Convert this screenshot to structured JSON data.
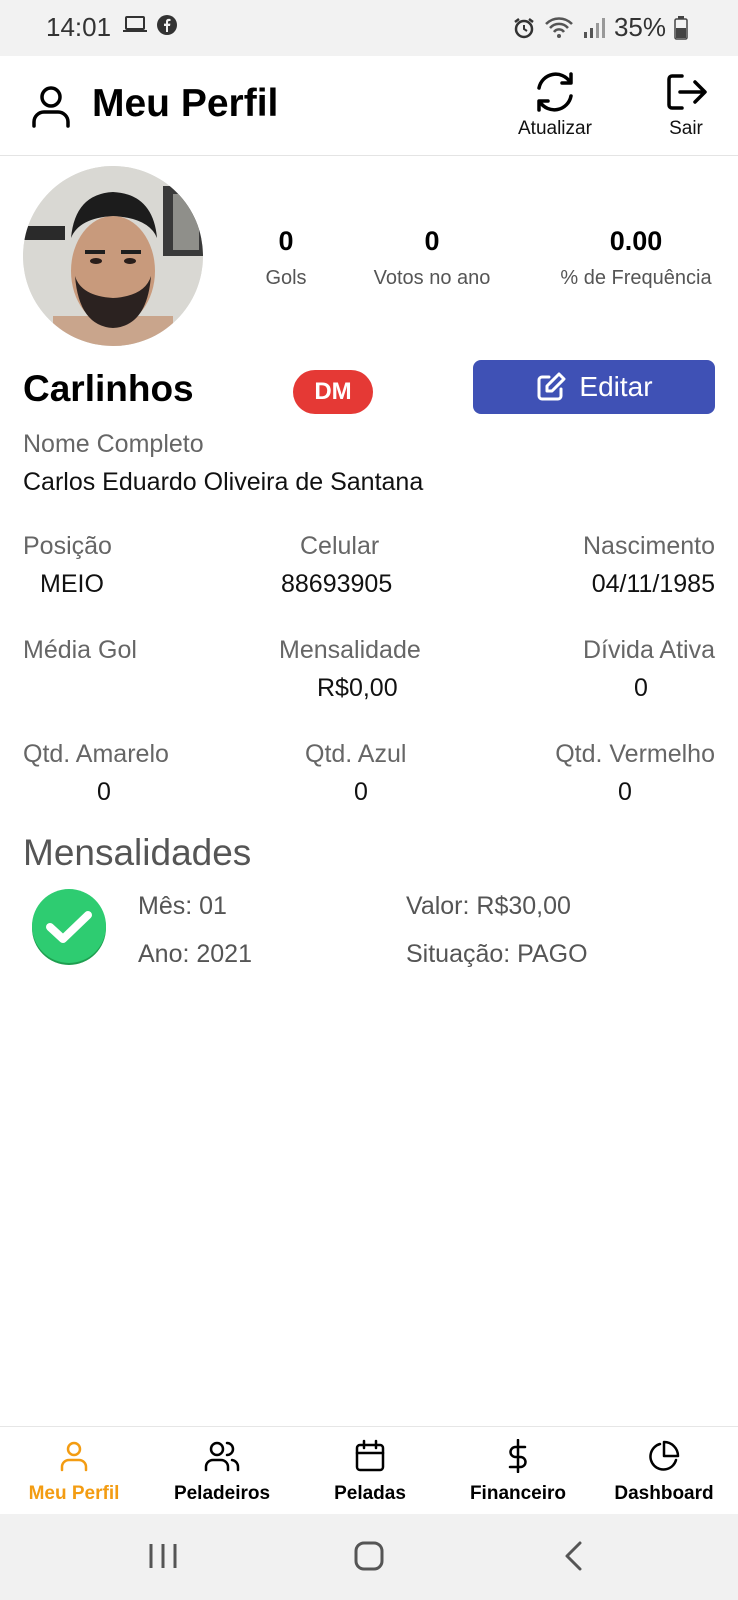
{
  "status_bar": {
    "time": "14:01",
    "battery": "35%"
  },
  "header": {
    "title": "Meu Perfil",
    "refresh_label": "Atualizar",
    "logout_label": "Sair"
  },
  "stats": [
    {
      "value": "0",
      "label": "Gols"
    },
    {
      "value": "0",
      "label": "Votos no ano"
    },
    {
      "value": "0.00",
      "label": "% de Frequência"
    }
  ],
  "profile": {
    "nickname": "Carlinhos",
    "badge": "DM",
    "edit_label": "Editar",
    "full_name_label": "Nome Completo",
    "full_name": "Carlos Eduardo Oliveira de Santana"
  },
  "fields": {
    "posicao": {
      "label": "Posição",
      "value": "MEIO"
    },
    "celular": {
      "label": "Celular",
      "value": "88693905"
    },
    "nascimento": {
      "label": "Nascimento",
      "value": "04/11/1985"
    },
    "media_gol": {
      "label": "Média Gol",
      "value": ""
    },
    "mensalidade": {
      "label": "Mensalidade",
      "value": "R$0,00"
    },
    "divida_ativa": {
      "label": "Dívida Ativa",
      "value": "0"
    },
    "qtd_amarelo": {
      "label": "Qtd. Amarelo",
      "value": "0"
    },
    "qtd_azul": {
      "label": "Qtd. Azul",
      "value": "0"
    },
    "qtd_vermelho": {
      "label": "Qtd. Vermelho",
      "value": "0"
    }
  },
  "mensalidades": {
    "title": "Mensalidades",
    "items": [
      {
        "mes": "Mês: 01",
        "ano": "Ano: 2021",
        "valor": "Valor: R$30,00",
        "situacao": "Situação: PAGO"
      }
    ]
  },
  "bottom_nav": {
    "items": [
      {
        "label": "Meu Perfil",
        "icon": "user-icon"
      },
      {
        "label": "Peladeiros",
        "icon": "users-icon"
      },
      {
        "label": "Peladas",
        "icon": "calendar-icon"
      },
      {
        "label": "Financeiro",
        "icon": "dollar-icon"
      },
      {
        "label": "Dashboard",
        "icon": "pie-chart-icon"
      }
    ]
  },
  "colors": {
    "accent": "#f39c12",
    "primary_button": "#3f51b5",
    "badge": "#e53935",
    "paid": "#2ecc71"
  }
}
